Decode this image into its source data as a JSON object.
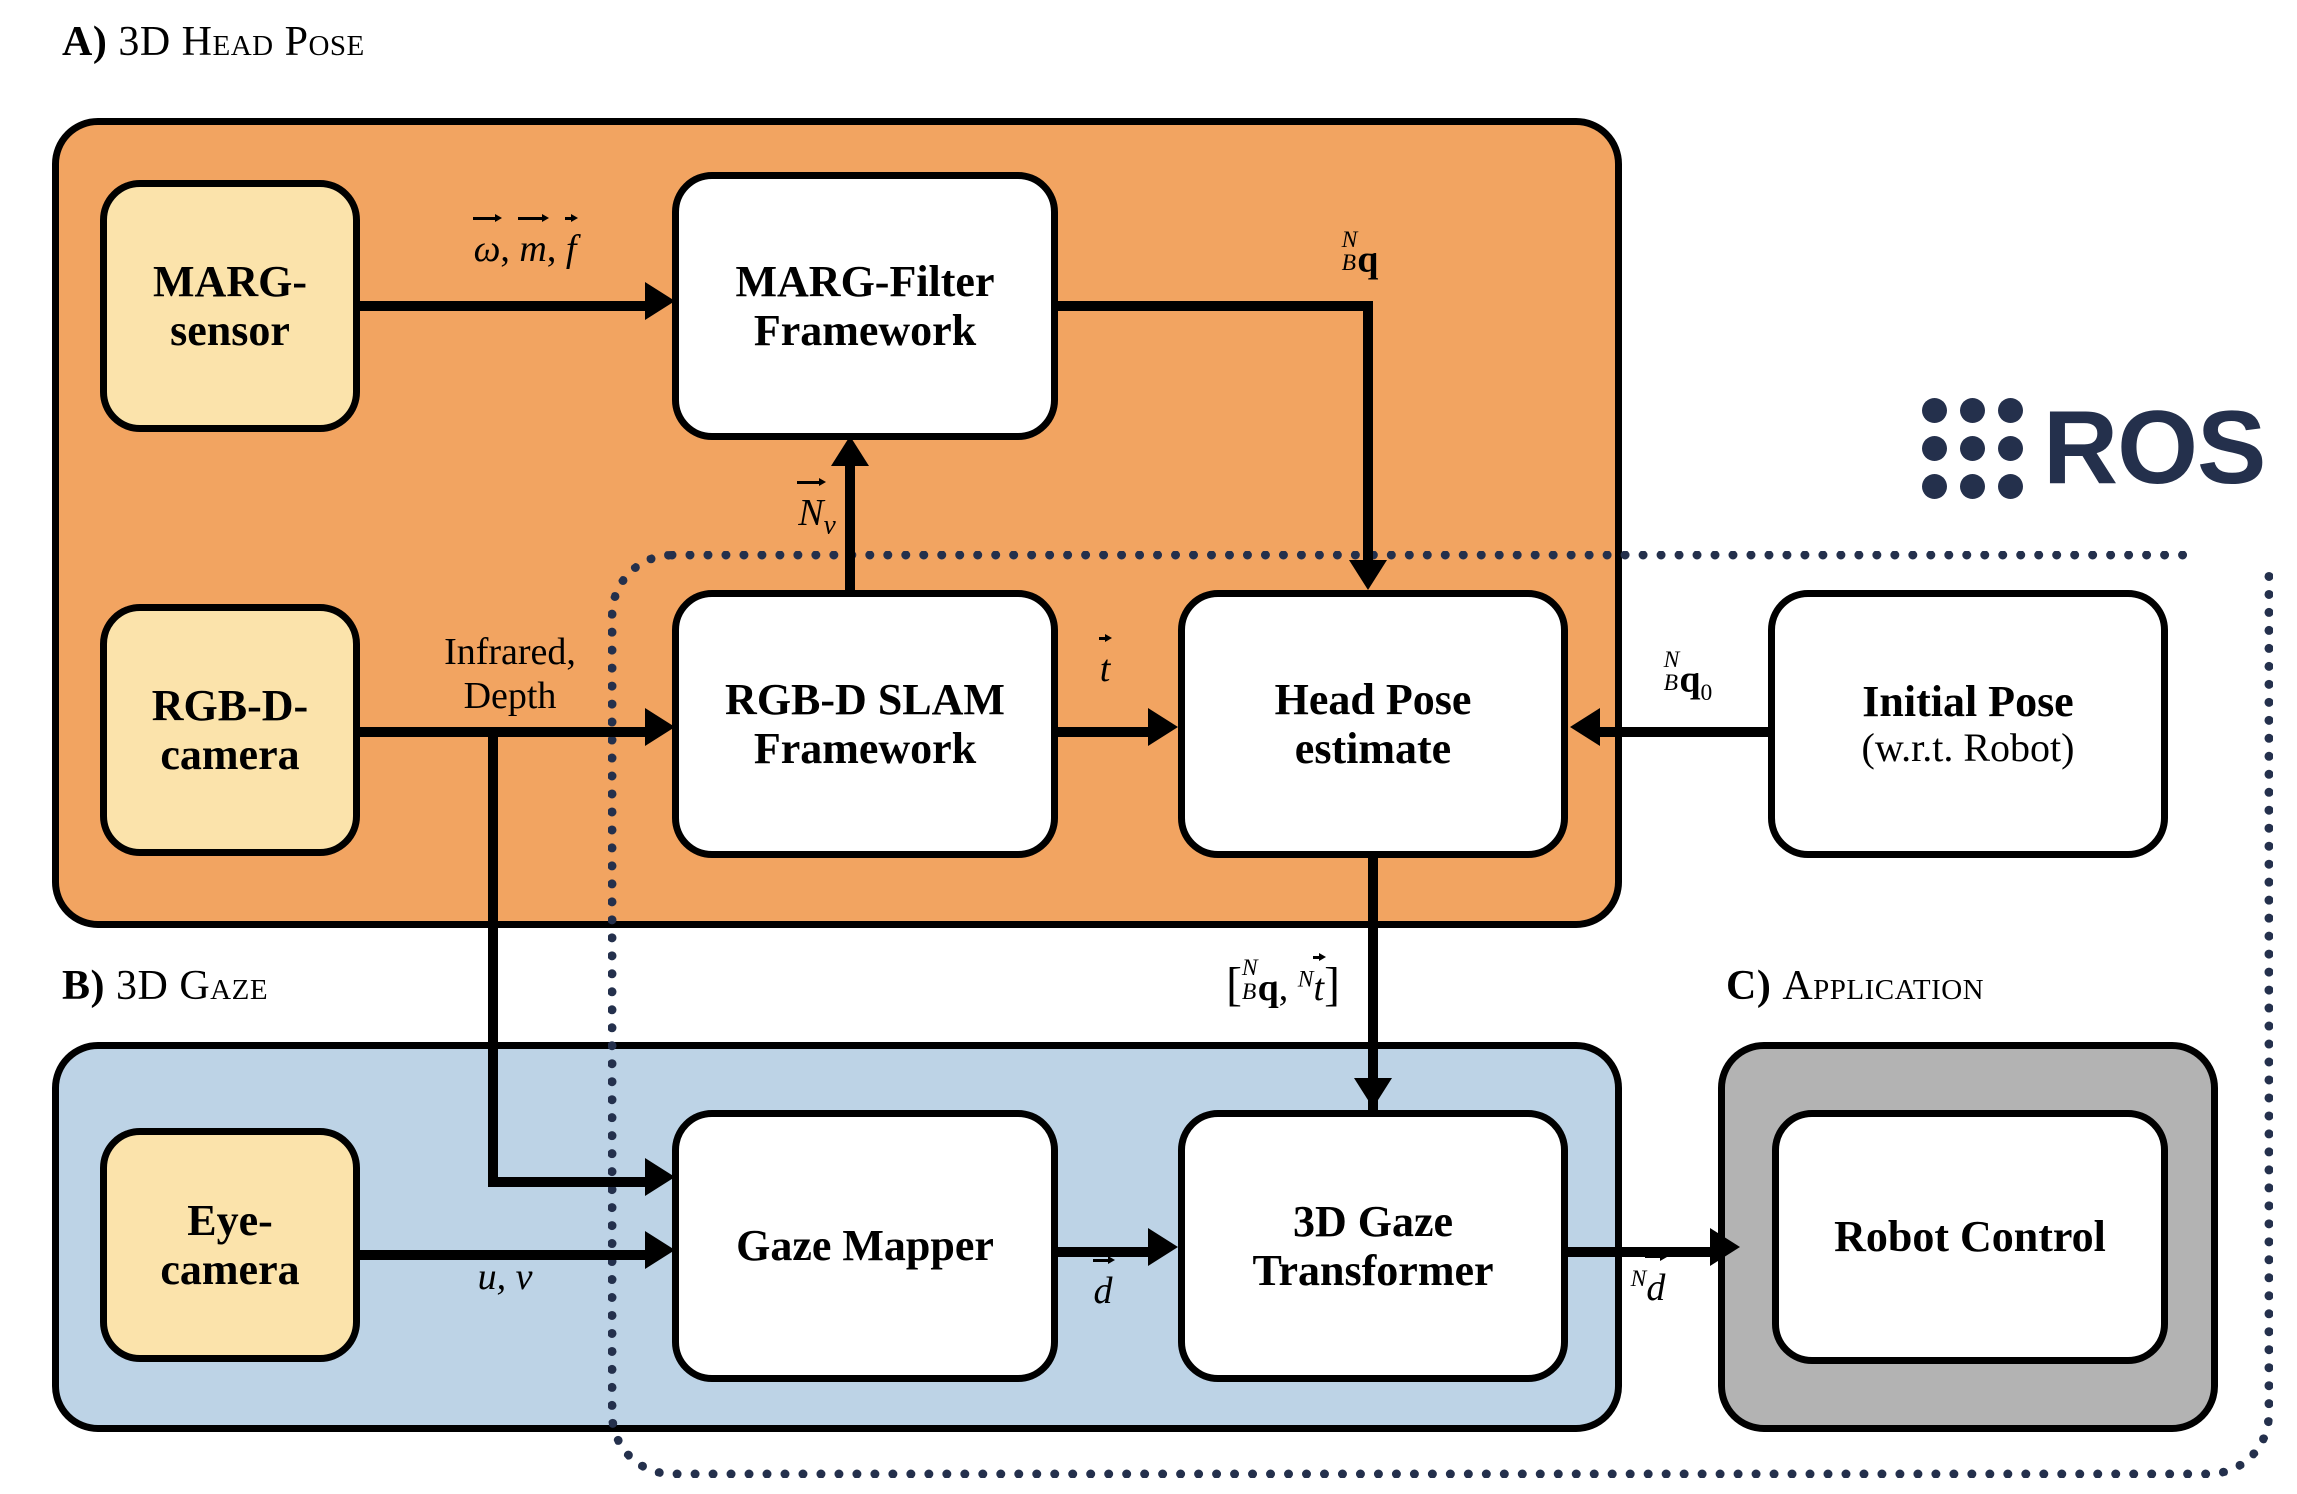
{
  "sections": {
    "a": {
      "index": "A)",
      "title": "3D Head Pose"
    },
    "b": {
      "index": "B)",
      "title": "3D Gaze"
    },
    "c": {
      "index": "C)",
      "title": "Application"
    }
  },
  "framework": {
    "name": "ROS",
    "logo_dots": 9,
    "logo_color": "#24304C"
  },
  "nodes": {
    "marg_sensor": {
      "line1": "MARG-",
      "line2": "sensor"
    },
    "marg_filter": {
      "line1": "MARG-Filter",
      "line2": "Framework"
    },
    "rgbd_camera": {
      "line1": "RGB-D-",
      "line2": "camera"
    },
    "rgbd_slam": {
      "line1": "RGB-D SLAM",
      "line2": "Framework"
    },
    "head_pose": {
      "line1": "Head Pose",
      "line2": "estimate"
    },
    "initial_pose": {
      "line1": "Initial Pose",
      "line2": "(w.r.t. Robot)"
    },
    "eye_camera": {
      "line1": "Eye-",
      "line2": "camera"
    },
    "gaze_mapper": {
      "line1": "Gaze Mapper",
      "line2": ""
    },
    "gaze_transformer": {
      "line1": "3D Gaze",
      "line2": "Transformer"
    },
    "robot_control": {
      "line1": "Robot Control",
      "line2": ""
    }
  },
  "edge_labels": {
    "imu": {
      "text": "w, m, f",
      "meaning": "omega-vec, m-vec, f-vec"
    },
    "quaternion": {
      "text": "N/B q",
      "meaning": "quaternion body-to-nav"
    },
    "normals": {
      "text": "N_v",
      "meaning": "visual normal vector"
    },
    "infrared": {
      "line1": "Infrared,",
      "line2": "Depth"
    },
    "translation": {
      "text": "t",
      "meaning": "translation vector"
    },
    "initial_quat": {
      "text": "N/B q_0",
      "meaning": "initial quaternion"
    },
    "pose_pair": {
      "text": "[N/B q, N t]",
      "meaning": "pose bracket"
    },
    "pixel_uv": {
      "text": "u, v"
    },
    "gaze_dir": {
      "text": "d",
      "meaning": "gaze direction vector"
    },
    "gaze_dir_nav": {
      "text": "N d",
      "meaning": "gaze direction in nav frame"
    }
  },
  "colors": {
    "head_pose_panel": "#F2A461",
    "gaze_panel": "#BDD3E6",
    "application_panel": "#B3B3B3",
    "sensor_node": "#FBE3AB",
    "process_node": "#FFFFFF",
    "ros_boundary": "#24304C",
    "stroke": "#000000"
  }
}
